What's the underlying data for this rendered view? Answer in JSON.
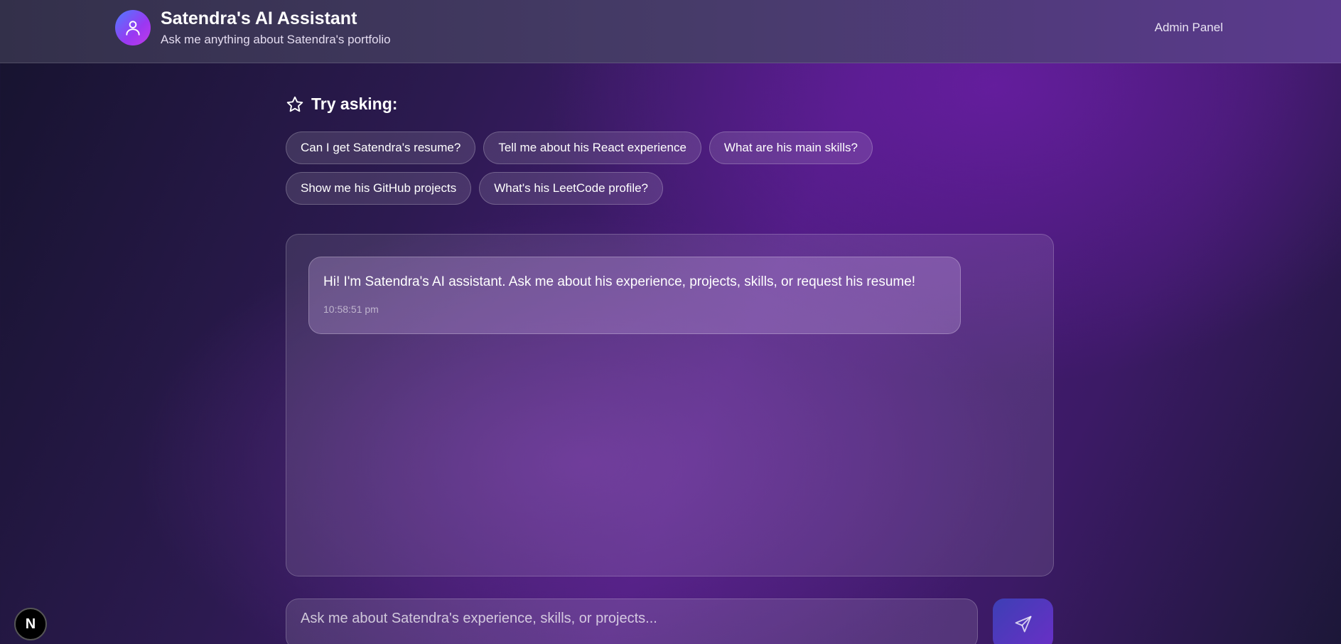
{
  "header": {
    "title": "Satendra's AI Assistant",
    "subtitle": "Ask me anything about Satendra's portfolio",
    "admin_link": "Admin Panel",
    "avatar_icon": "user-icon"
  },
  "suggestions": {
    "heading": "Try asking:",
    "heading_icon": "star-icon",
    "chips": [
      "Can I get Satendra's resume?",
      "Tell me about his React experience",
      "What are his main skills?",
      "Show me his GitHub projects",
      "What's his LeetCode profile?"
    ]
  },
  "chat": {
    "messages": [
      {
        "text": "Hi! I'm Satendra's AI assistant. Ask me about his experience, projects, skills, or request his resume!",
        "time": "10:58:51 pm"
      }
    ]
  },
  "composer": {
    "placeholder": "Ask me about Satendra's experience, skills, or projects...",
    "send_icon": "send-icon"
  },
  "badge": {
    "label": "N"
  },
  "colors": {
    "accent_start": "#4d7cff",
    "accent_end": "#9a38f2",
    "send_button": "#5a35c0"
  }
}
